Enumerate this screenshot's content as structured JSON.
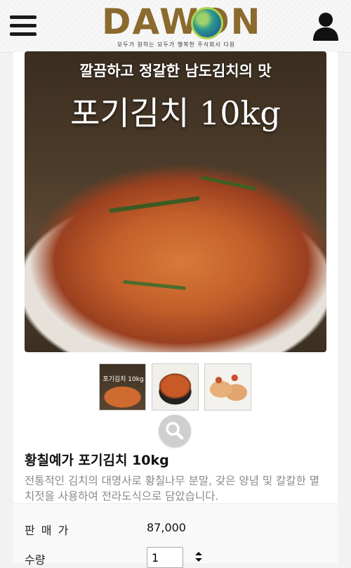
{
  "header": {
    "logo_text": "DAWON",
    "logo_tagline": "모두가 원하는 모두가 행복한 주식회사 다원",
    "menu_icon": "hamburger-menu-icon",
    "user_icon": "user-profile-icon"
  },
  "product_image": {
    "subtitle": "깔끔하고 정갈한 남도김치의 맛",
    "title": "포기김치 10kg"
  },
  "thumbnails": [
    {
      "label": "포기김치 10kg"
    },
    {
      "label": ""
    },
    {
      "label": ""
    }
  ],
  "zoom_icon": "magnifier-icon",
  "product": {
    "name": "황칠예가 포기김치 10kg",
    "description": "전통적인 김치의 대명사로 황칠나무 분말, 갖은 양념 및 칼칼한 멸치젓을 사용하여 전라도식으로 담았습니다."
  },
  "price": {
    "label": "판 매 가",
    "value": "87,000"
  },
  "quantity": {
    "label": "수량",
    "value": "1"
  },
  "colors": {
    "logo_brown": "#8a6a2d",
    "logo_green": "#b0d24d",
    "description_gray": "#8a8a8a"
  }
}
